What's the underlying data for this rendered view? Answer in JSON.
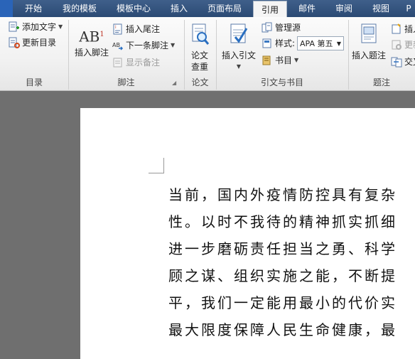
{
  "tabs": [
    "开始",
    "我的模板",
    "模板中心",
    "插入",
    "页面布局",
    "引用",
    "邮件",
    "审阅",
    "视图",
    "P"
  ],
  "active_tab": "引用",
  "ribbon": {
    "toc": {
      "add_text": "添加文字",
      "update_toc": "更新目录",
      "group": "目录"
    },
    "footnotes": {
      "insert_footnote": "插入脚注",
      "insert_endnote": "插入尾注",
      "next_footnote": "下一条脚注",
      "show_notes": "显示备注",
      "group": "脚注",
      "big_icon_text": "AB"
    },
    "paper": {
      "label_line1": "论文",
      "label_line2": "查重",
      "group": "论文"
    },
    "citations": {
      "insert_citation": "插入引文",
      "manage_sources": "管理源",
      "style_label": "样式:",
      "style_value": "APA 第五",
      "bibliography": "书目",
      "group": "引文与书目"
    },
    "captions": {
      "insert_caption": "插入题注",
      "insert_partial": "插入",
      "update_partial": "更新",
      "cross_partial": "交叉",
      "group": "题注"
    }
  },
  "document": {
    "lines": [
      "当前，国内外疫情防控具有复杂",
      "性。以时不我待的精神抓实抓细",
      "进一步磨砺责任担当之勇、科学",
      "顾之谋、组织实施之能，不断提",
      "平，我们一定能用最小的代价实",
      "最大限度保障人民生命健康，最"
    ]
  }
}
